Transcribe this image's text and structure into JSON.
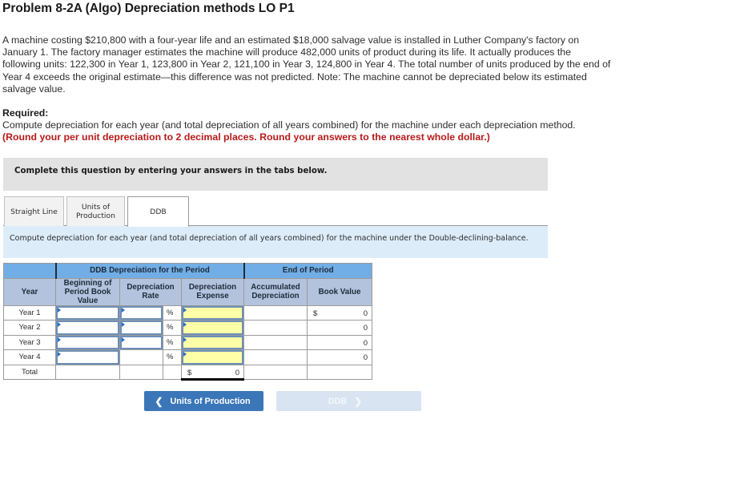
{
  "problem": {
    "title": "Problem 8-2A (Algo) Depreciation methods LO P1",
    "description": "A machine costing $210,800 with a four-year life and an estimated $18,000 salvage value is installed in Luther Company's factory on January 1. The factory manager estimates the machine will produce 482,000 units of product during its life. It actually produces the following units: 122,300 in Year 1, 123,800 in Year 2, 121,100 in Year 3, 124,800 in Year 4. The total number of units produced by the end of Year 4 exceeds the original estimate—this difference was not predicted. Note: The machine cannot be depreciated below its estimated salvage value.",
    "required_label": "Required:",
    "required_text": "Compute depreciation for each year (and total depreciation of all years combined) for the machine under each depreciation method.",
    "required_note": "(Round your per unit depreciation to 2 decimal places. Round your answers to the nearest whole dollar.)"
  },
  "instructions": "Complete this question by entering your answers in the tabs below.",
  "tabs": [
    {
      "label_line1": "Straight Line",
      "label_line2": "",
      "active": false
    },
    {
      "label_line1": "Units of",
      "label_line2": "Production",
      "active": false
    },
    {
      "label_line1": "DDB",
      "label_line2": "",
      "active": true
    }
  ],
  "tab_instruction": "Compute depreciation for each year (and total depreciation of all years combined) for the machine under the Double-declining-balance.",
  "table": {
    "group_headers": {
      "period": "DDB Depreciation for the Period",
      "end": "End of Period"
    },
    "columns": {
      "year": "Year",
      "beginning_line1": "Beginning of",
      "beginning_line2": "Period Book",
      "beginning_line3": "Value",
      "rate_line1": "Depreciation",
      "rate_line2": "Rate",
      "expense_line1": "Depreciation",
      "expense_line2": "Expense",
      "accum_line1": "Accumulated",
      "accum_line2": "Depreciation",
      "book": "Book Value"
    },
    "percent_symbol": "%",
    "currency_symbol": "$",
    "rows": [
      {
        "year": "Year 1",
        "beginning": "",
        "rate": "",
        "expense": "",
        "accumulated": "",
        "book_value": "0"
      },
      {
        "year": "Year 2",
        "beginning": "",
        "rate": "",
        "expense": "",
        "accumulated": "",
        "book_value": "0"
      },
      {
        "year": "Year 3",
        "beginning": "",
        "rate": "",
        "expense": "",
        "accumulated": "",
        "book_value": "0"
      },
      {
        "year": "Year 4",
        "beginning": "",
        "rate": "",
        "expense": "",
        "accumulated": "",
        "book_value": "0"
      }
    ],
    "total": {
      "label": "Total",
      "expense": "0"
    }
  },
  "nav": {
    "prev_label": "Units of Production",
    "next_label": "DDB",
    "prev_icon": "chevron-left-icon",
    "next_icon": "chevron-right-icon"
  }
}
